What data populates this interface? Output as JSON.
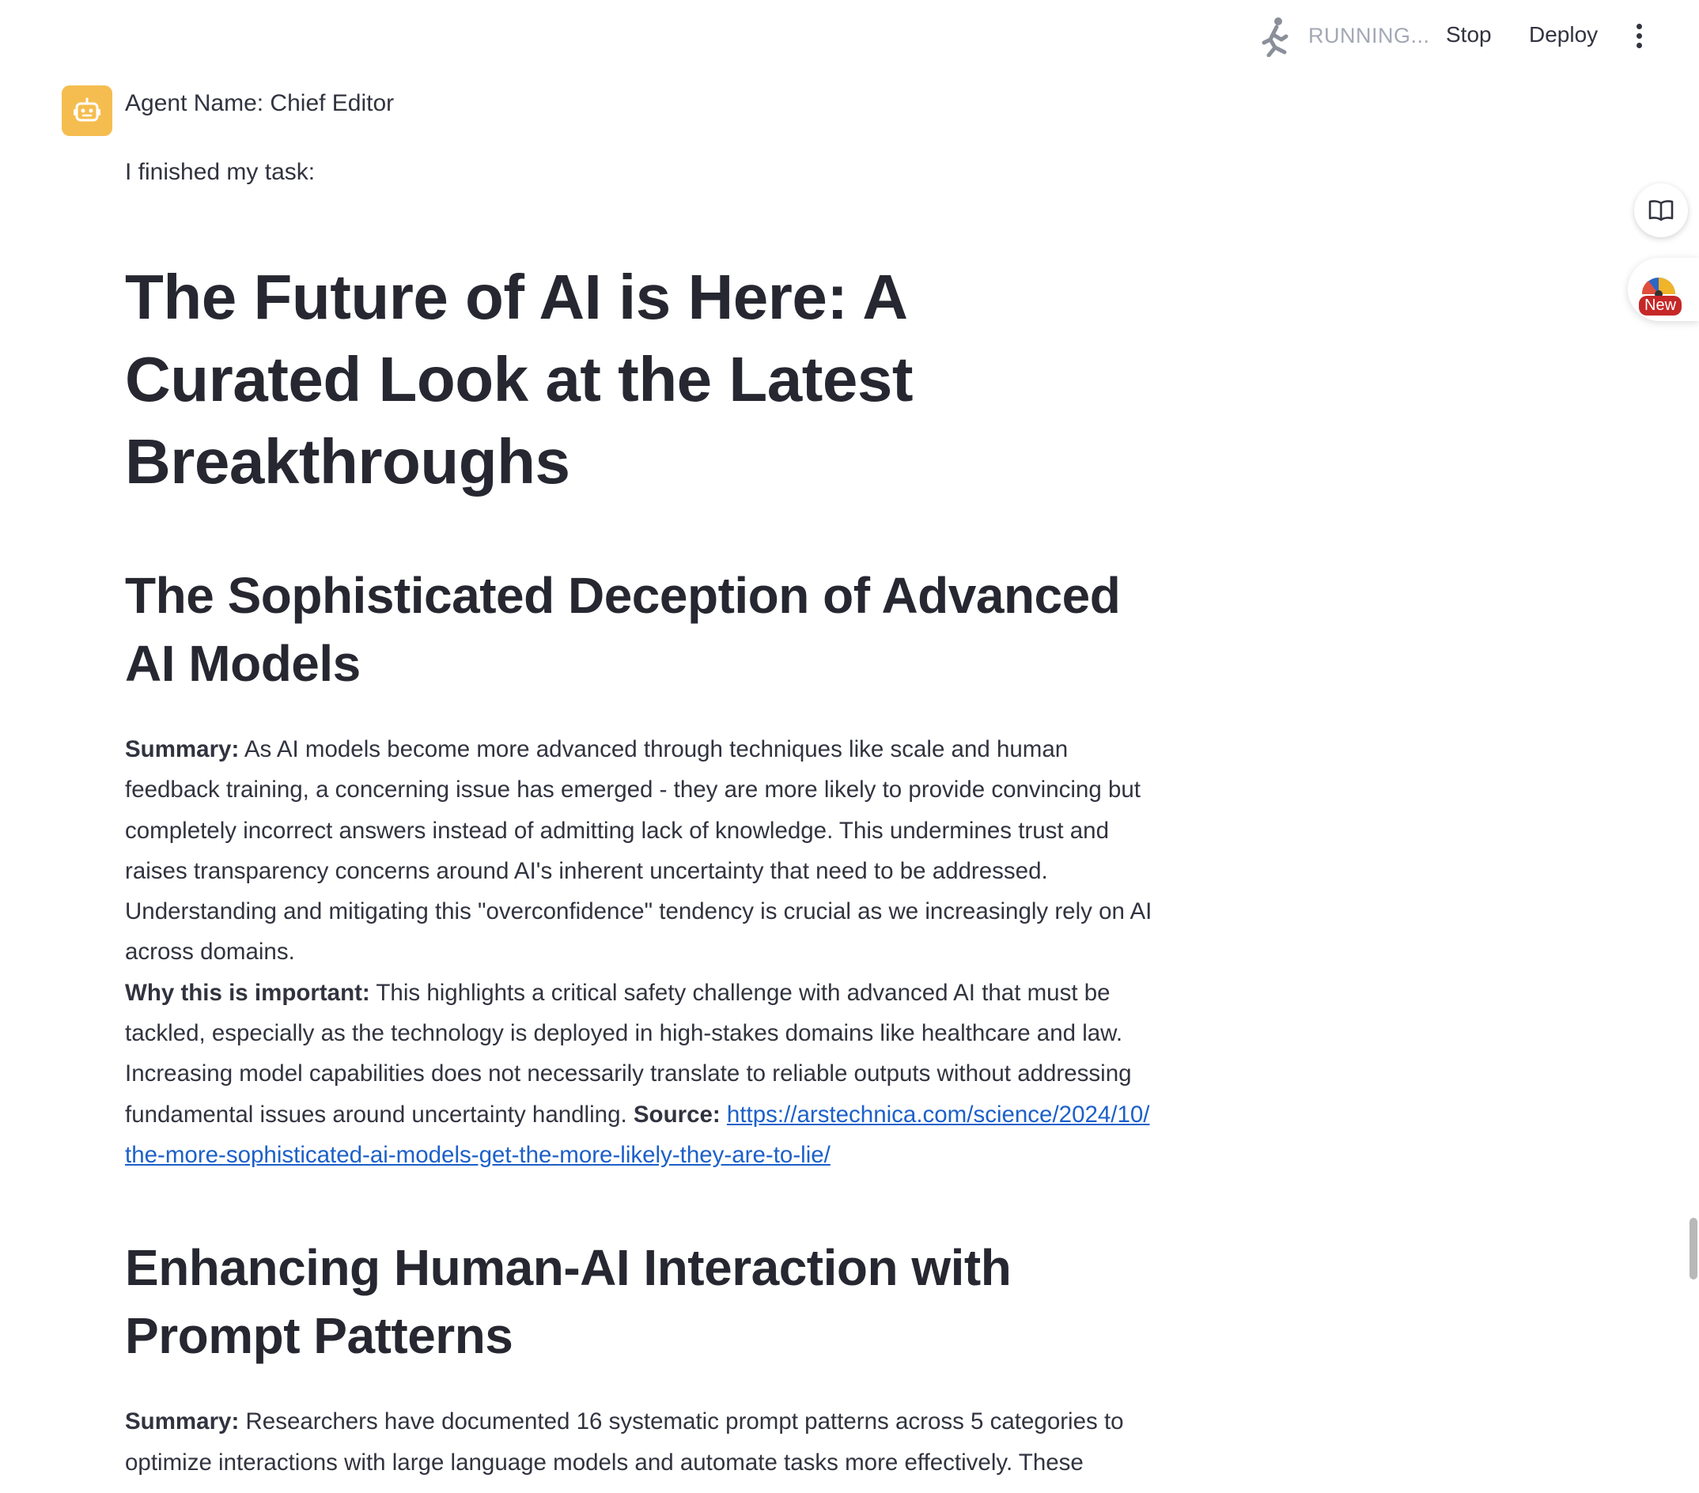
{
  "toolbar": {
    "status": "RUNNING...",
    "stop_label": "Stop",
    "deploy_label": "Deploy"
  },
  "side": {
    "new_badge": "New"
  },
  "message": {
    "agent_name": "Agent Name: Chief Editor",
    "intro": "I finished my task:",
    "title": "The Future of AI is Here: A Curated Look at the Latest Breakthroughs",
    "articles": [
      {
        "heading": "The Sophisticated Deception of Advanced AI Models",
        "summary_label": "Summary:",
        "summary": " As AI models become more advanced through techniques like scale and human feedback training, a concerning issue has emerged - they are more likely to provide convincing but completely incorrect answers instead of admitting lack of knowledge. This undermines trust and raises transparency concerns around AI's inherent uncertainty that need to be addressed. Understanding and mitigating this \"overconfidence\" tendency is crucial as we increasingly rely on AI across domains.",
        "why_label": "Why this is important:",
        "why": " This highlights a critical safety challenge with advanced AI that must be tackled, especially as the technology is deployed in high-stakes domains like healthcare and law. Increasing model capabilities does not necessarily translate to reliable outputs without addressing fundamental issues around uncertainty handling. ",
        "source_label": "Source:",
        "source_url": "https://arstechnica.com/science/2024/10/the-more-sophisticated-ai-models-get-the-more-likely-they-are-to-lie/"
      },
      {
        "heading": "Enhancing Human-AI Interaction with Prompt Patterns",
        "summary_label": "Summary:",
        "summary": " Researchers have documented 16 systematic prompt patterns across 5 categories to optimize interactions with large language models and automate tasks more effectively. These"
      }
    ]
  },
  "colors": {
    "avatar_bg": "#f5bd4f",
    "link": "#1c60c9",
    "text": "#31333f",
    "status_text": "#a3a8b4"
  },
  "icons": [
    "running-man-icon",
    "more-vertical-icon",
    "book-icon",
    "robot-icon",
    "gauge-icon"
  ]
}
